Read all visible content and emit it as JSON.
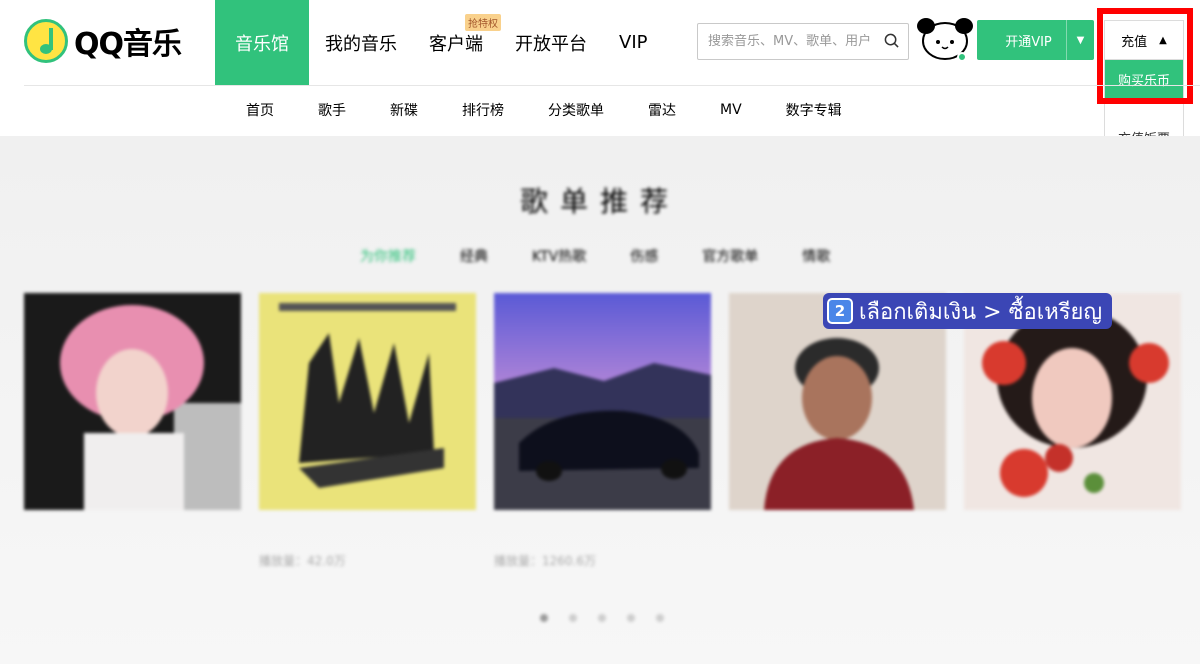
{
  "brand": {
    "logo_text": "QQ音乐"
  },
  "main_nav": [
    {
      "label": "音乐馆",
      "active": true
    },
    {
      "label": "我的音乐"
    },
    {
      "label": "客户端",
      "badge": "抢特权"
    },
    {
      "label": "开放平台"
    },
    {
      "label": "VIP"
    }
  ],
  "search": {
    "placeholder": "搜索音乐、MV、歌单、用户"
  },
  "vip_button": {
    "label": "开通VIP",
    "caret": "▼"
  },
  "recharge": {
    "label": "充值",
    "caret": "▲",
    "menu": [
      {
        "label": "购买乐币",
        "highlighted": true
      },
      {
        "label": "充值饭票"
      }
    ]
  },
  "sub_nav": [
    "首页",
    "歌手",
    "新碟",
    "排行榜",
    "分类歌单",
    "雷达",
    "MV",
    "数字专辑"
  ],
  "section": {
    "title": "歌单推荐",
    "tabs": [
      {
        "label": "为你推荐",
        "active": true
      },
      {
        "label": "经典"
      },
      {
        "label": "KTV热歌"
      },
      {
        "label": "伤感"
      },
      {
        "label": "官方歌单"
      },
      {
        "label": "情歌"
      }
    ]
  },
  "cards": [
    {
      "title": "",
      "sub": ""
    },
    {
      "title": "",
      "sub": "播放量：42.0万"
    },
    {
      "title": "",
      "sub": "播放量：1260.6万"
    },
    {
      "title": "",
      "sub": ""
    },
    {
      "title": "",
      "sub": ""
    }
  ],
  "pagination": {
    "count": 5,
    "active": 0
  },
  "annotation": {
    "step": "2",
    "text": "เลือกเติมเงิน > ซื้อเหรียญ"
  },
  "colors": {
    "accent": "#31c27c",
    "highlight_box": "#ff0000",
    "annotation_bg": "#3b46b5"
  }
}
